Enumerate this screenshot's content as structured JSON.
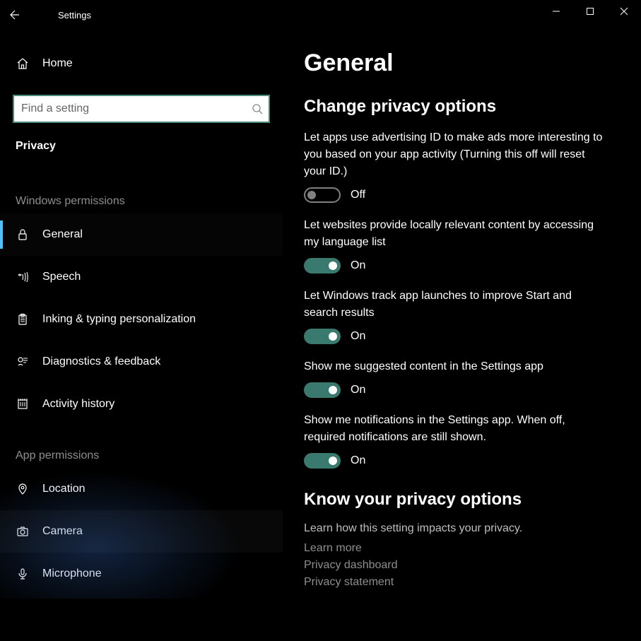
{
  "titlebar": {
    "title": "Settings"
  },
  "sidebar": {
    "home": "Home",
    "search_placeholder": "Find a setting",
    "category": "Privacy",
    "group_windows": "Windows permissions",
    "group_app": "App permissions",
    "items_win": [
      {
        "label": "General",
        "selected": true
      },
      {
        "label": "Speech"
      },
      {
        "label": "Inking & typing personalization"
      },
      {
        "label": "Diagnostics & feedback"
      },
      {
        "label": "Activity history"
      }
    ],
    "items_app": [
      {
        "label": "Location"
      },
      {
        "label": "Camera"
      },
      {
        "label": "Microphone"
      }
    ]
  },
  "content": {
    "title": "General",
    "section_privacy": "Change privacy options",
    "settings": [
      {
        "desc": "Let apps use advertising ID to make ads more interesting to you based on your app activity (Turning this off will reset your ID.)",
        "state": "Off",
        "on": false
      },
      {
        "desc": "Let websites provide locally relevant content by accessing my language list",
        "state": "On",
        "on": true
      },
      {
        "desc": "Let Windows track app launches to improve Start and search results",
        "state": "On",
        "on": true
      },
      {
        "desc": "Show me suggested content in the Settings app",
        "state": "On",
        "on": true
      },
      {
        "desc": "Show me notifications in the Settings app. When off, required notifications are still shown.",
        "state": "On",
        "on": true
      }
    ],
    "know": {
      "heading": "Know your privacy options",
      "sub": "Learn how this setting impacts your privacy.",
      "links": [
        "Learn more",
        "Privacy dashboard",
        "Privacy statement"
      ]
    }
  }
}
